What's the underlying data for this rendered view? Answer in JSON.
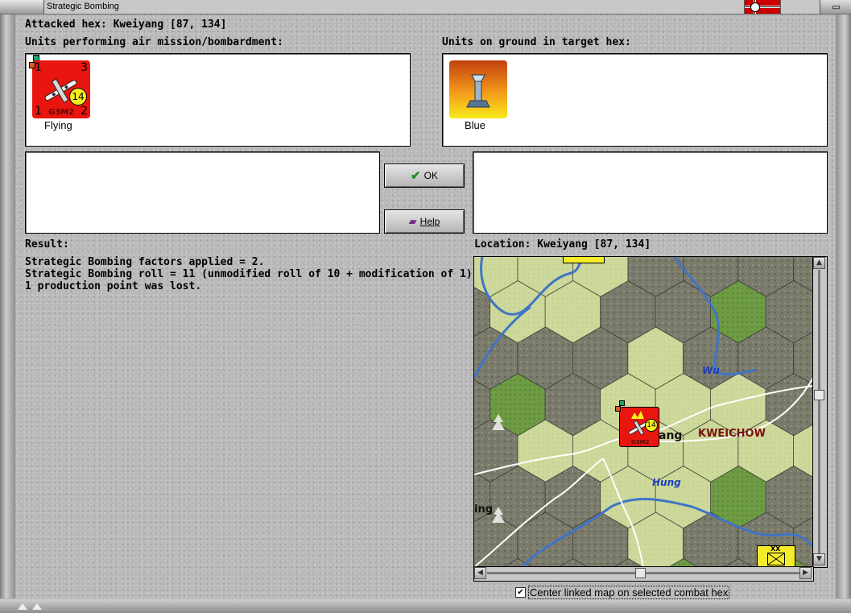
{
  "window": {
    "title": "Strategic Bombing"
  },
  "attacked_hex": "Attacked hex: Kweiyang  [87, 134]",
  "air_units": {
    "header": "Units performing air mission/bombardment:",
    "units": [
      {
        "type": "G3M2",
        "status": "Flying",
        "top_left": "1",
        "top_right": "3",
        "bottom_left": "1",
        "bottom_right": "2",
        "strength": "14",
        "color": "#e8160f"
      }
    ]
  },
  "ground_units": {
    "header": "Units on ground in target hex:",
    "units": [
      {
        "label": "Blue",
        "icon": "factory-smokestack-icon"
      }
    ]
  },
  "buttons": {
    "ok": "OK",
    "help": "Help"
  },
  "result": {
    "header": "Result:",
    "lines": [
      "Strategic Bombing factors applied = 2.",
      "Strategic Bombing roll = 11 (unmodified roll of 10 + modification of 1).",
      "1 production point was lost."
    ]
  },
  "location": {
    "header": "Location:  Kweiyang  [87, 134]",
    "map_labels": {
      "city": "ang",
      "province": "KWEICHOW",
      "river1": "Wu",
      "river2": "Hung",
      "partial": "ing"
    },
    "map_unit": {
      "type": "G3M2",
      "strength": "14"
    },
    "corner_unit": {
      "size": "XX"
    }
  },
  "options": {
    "center_linked_map": {
      "label": "Center linked map on selected combat hex",
      "checked": true
    }
  },
  "colors": {
    "clear": "#cdd99a",
    "rough": "#7b7b6c",
    "forest": "#6e9b44",
    "river": "#3f74c6",
    "road": "#ffffff"
  }
}
